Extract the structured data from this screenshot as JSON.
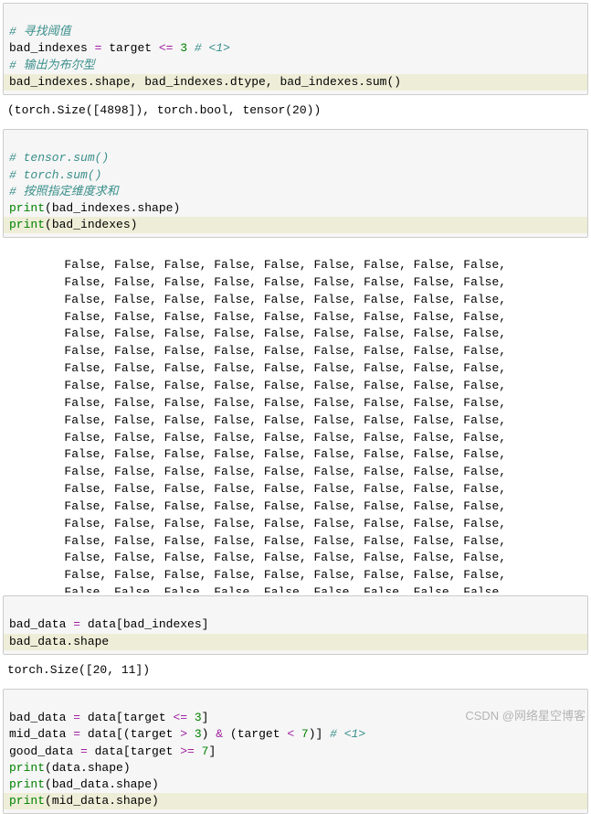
{
  "cell1": {
    "c1": "# 寻找阈值",
    "l1a": "bad_indexes ",
    "l1b": "=",
    "l1c": " target ",
    "l1d": "<=",
    "l1e": " 3",
    "l1f": " # <1>",
    "c2": "# 输出为布尔型",
    "l2": "bad_indexes.shape, bad_indexes.dtype, bad_indexes.sum()"
  },
  "out1": "(torch.Size([4898]), torch.bool, tensor(20))",
  "cell2": {
    "c1": "# tensor.sum()",
    "c2": "# torch.sum()",
    "c3": "# 按照指定维度求和",
    "p1a": "print",
    "p1b": "(bad_indexes.shape)",
    "p2a": "print",
    "p2b": "(bad_indexes)"
  },
  "out2row": "        False, False, False, False, False, False, False, False, False,",
  "out2rowTop": "        False, False, False, False, False, False, False, False, False,",
  "cell3": {
    "l1a": "bad_data ",
    "l1b": "=",
    "l1c": " data[bad_indexes]",
    "l2": "bad_data.shape"
  },
  "out3": "torch.Size([20, 11])",
  "cell4": {
    "l1a": "bad_data ",
    "l1b": "=",
    "l1c": " data[target ",
    "l1d": "<=",
    "l1e": " 3",
    "l1f": "]",
    "l2a": "mid_data ",
    "l2b": "=",
    "l2c": " data[(target ",
    "l2d": ">",
    "l2e": " 3",
    "l2f": ") ",
    "l2g": "&",
    "l2h": " (target ",
    "l2i": "<",
    "l2j": " 7",
    "l2k": ")] ",
    "l2l": "# <1>",
    "l3a": "good_data ",
    "l3b": "=",
    "l3c": " data[target ",
    "l3d": ">=",
    "l3e": " 7",
    "l3f": "]",
    "p1a": "print",
    "p1b": "(data.shape)",
    "p2a": "print",
    "p2b": "(bad_data.shape)",
    "p3a": "print",
    "p3b": "(mid_data.shape)"
  },
  "watermark": "CSDN @网络星空博客"
}
